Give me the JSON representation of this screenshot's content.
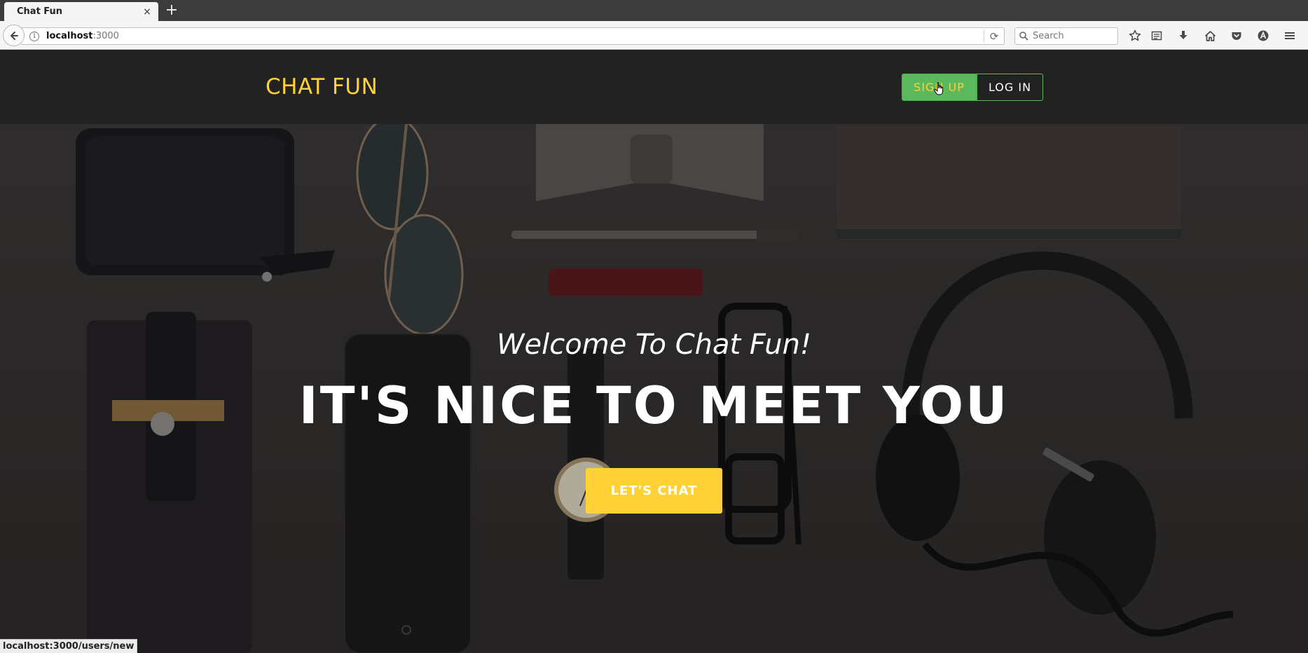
{
  "browser": {
    "tab_title": "Chat Fun",
    "tab_close": "×",
    "new_tab": "+",
    "url_host": "localhost",
    "url_port": ":3000",
    "search_placeholder": "Search",
    "info_glyph": "i",
    "reload_glyph": "⟳",
    "status_text": "localhost:3000/users/new",
    "toolbar_icons": [
      "bookmark-star-icon",
      "reading-list-icon",
      "download-icon",
      "home-icon",
      "pocket-icon",
      "account-icon",
      "menu-icon"
    ]
  },
  "site": {
    "brand": "CHAT FUN",
    "signup_label": "SIGN UP",
    "login_label": "LOG IN"
  },
  "hero": {
    "welcome": "Welcome To Chat Fun!",
    "headline": "IT'S NICE TO MEET YOU",
    "cta_label": "LET'S CHAT"
  },
  "colors": {
    "brand": "#fed136",
    "signup_bg": "#5cb85c",
    "header_bg": "#222222",
    "cta_bg": "#fed136"
  }
}
